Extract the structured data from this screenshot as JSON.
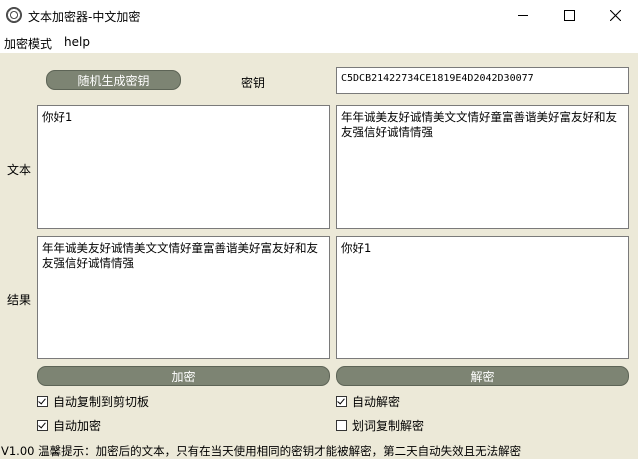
{
  "window": {
    "title": "文本加密器-中文加密",
    "icon": "app-logo-icon"
  },
  "menu": {
    "items": [
      "加密模式",
      "help"
    ]
  },
  "key_row": {
    "generate_label": "随机生成密钥",
    "key_label": "密钥",
    "key_value": "C5DCB21422734CE1819E4D2042D30077"
  },
  "rows": {
    "text_label": "文本",
    "result_label": "结果"
  },
  "fields": {
    "text_left": "你好1",
    "text_right": "年年诚美友好诚情美文文情好童富善谐美好富友好和友友强信好诚情情强",
    "result_left": "年年诚美友好诚情美文文情好童富善谐美好富友好和友友强信好诚情情强",
    "result_right": "你好1"
  },
  "actions": {
    "encrypt_label": "加密",
    "decrypt_label": "解密"
  },
  "options": {
    "auto_copy_label": "自动复制到剪切板",
    "auto_copy_checked": true,
    "auto_encrypt_label": "自动加密",
    "auto_encrypt_checked": true,
    "auto_decrypt_label": "自动解密",
    "auto_decrypt_checked": true,
    "select_copy_decrypt_label": "划词复制解密",
    "select_copy_decrypt_checked": false
  },
  "status": {
    "text": "V1.00 温馨提示：加密后的文本，只有在当天使用相同的密钥才能被解密，第二天自动失效且无法解密"
  },
  "colors": {
    "client_bg": "#ece9d8",
    "button_bg": "#7d8473"
  }
}
